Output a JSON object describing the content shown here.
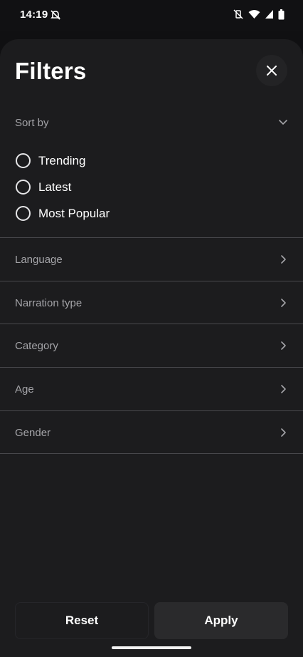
{
  "status": {
    "time": "14:19",
    "left_icon": "notifications-off-icon",
    "right_icons": [
      "vibrate-icon",
      "wifi-icon",
      "signal-icon",
      "battery-icon"
    ]
  },
  "header": {
    "title": "Filters",
    "close_icon": "close-icon"
  },
  "sort": {
    "label": "Sort by",
    "options": [
      "Trending",
      "Latest",
      "Most Popular"
    ]
  },
  "sections": [
    "Language",
    "Narration type",
    "Category",
    "Age",
    "Gender"
  ],
  "actions": {
    "reset": "Reset",
    "apply": "Apply"
  },
  "colors": {
    "sheet": "#1c1c1e",
    "background": "#101012",
    "divider": "#48484c",
    "muted_text": "#a4a4a8"
  }
}
